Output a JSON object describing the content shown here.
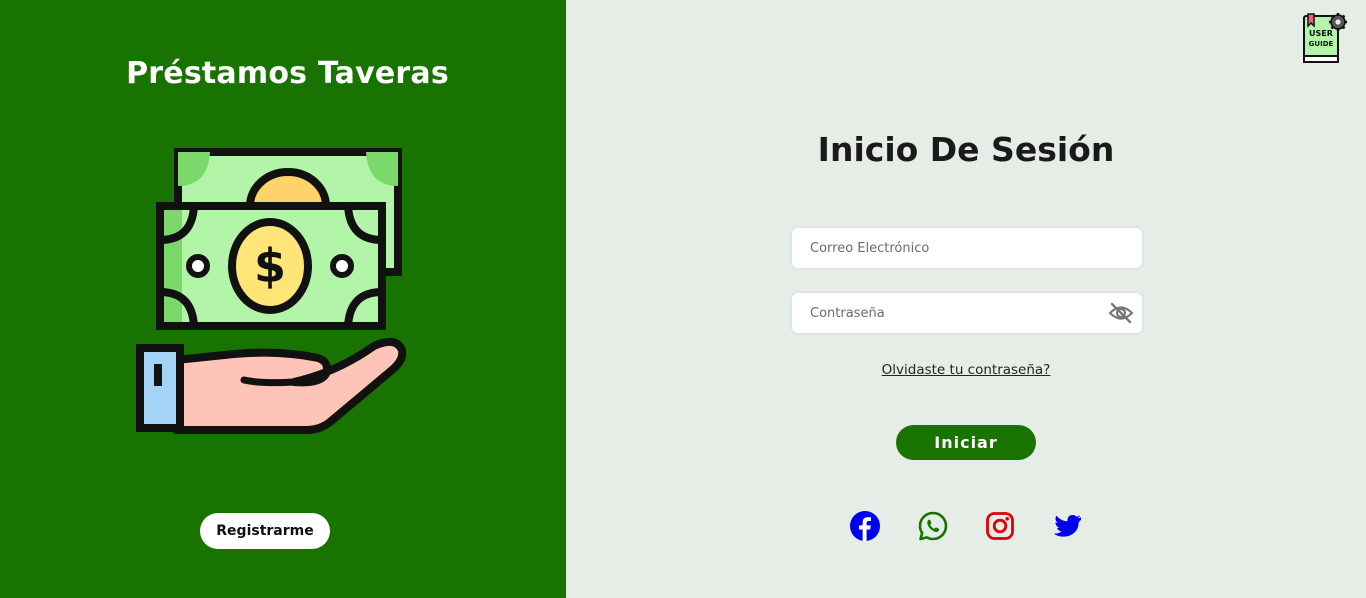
{
  "brand": {
    "title": "Préstamos Taveras",
    "illustration_icon": "money-on-hand-icon"
  },
  "left": {
    "register_label": "Registrarme"
  },
  "header": {
    "guide_icon": "user-guide-icon",
    "guide_text_1": "USER",
    "guide_text_2": "GUIDE"
  },
  "login": {
    "title": "Inicio De Sesión",
    "email_placeholder": "Correo Electrónico",
    "email_value": "",
    "password_placeholder": "Contraseña",
    "password_value": "",
    "password_toggle_icon": "eye-slash-icon",
    "forgot_label": "Olvidaste tu contraseña?",
    "submit_label": "Iniciar"
  },
  "social": [
    {
      "name": "facebook-icon",
      "color": "#0000ee"
    },
    {
      "name": "whatsapp-icon",
      "color": "#197300"
    },
    {
      "name": "instagram-icon",
      "color": "#e00000"
    },
    {
      "name": "twitter-icon",
      "color": "#0000ee"
    }
  ],
  "colors": {
    "brand_green": "#197300",
    "panel_bg": "#e6ede7",
    "bill_green": "#b3f5a8",
    "coin_yellow": "#ffe477",
    "hand_skin": "#ffc4b8",
    "cuff_blue": "#a3d3f7"
  }
}
